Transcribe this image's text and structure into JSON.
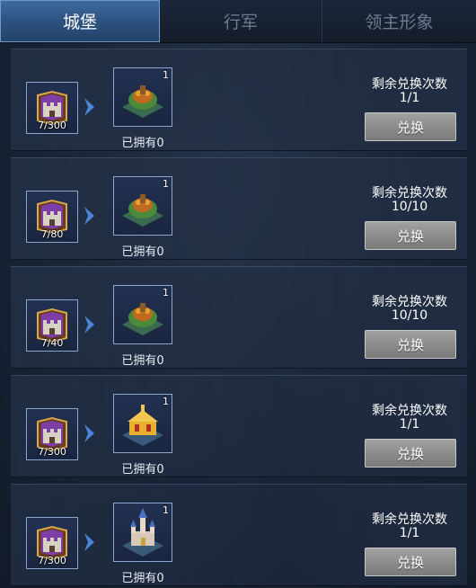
{
  "tabs": [
    {
      "label": "城堡",
      "active": true
    },
    {
      "label": "行军",
      "active": false
    },
    {
      "label": "领主形象",
      "active": false
    }
  ],
  "exchange_rows": [
    {
      "cost": "7/300",
      "quantity": "1",
      "owned": "已拥有0",
      "remain_label": "剩余兑换次数",
      "remain_value": "1/1",
      "button": "兑换",
      "reward_icon": "turtle-castle-icon"
    },
    {
      "cost": "7/80",
      "quantity": "1",
      "owned": "已拥有0",
      "remain_label": "剩余兑换次数",
      "remain_value": "10/10",
      "button": "兑换",
      "reward_icon": "turtle-castle-icon"
    },
    {
      "cost": "7/40",
      "quantity": "1",
      "owned": "已拥有0",
      "remain_label": "剩余兑换次数",
      "remain_value": "10/10",
      "button": "兑换",
      "reward_icon": "turtle-castle-icon"
    },
    {
      "cost": "7/300",
      "quantity": "1",
      "owned": "已拥有0",
      "remain_label": "剩余兑换次数",
      "remain_value": "1/1",
      "button": "兑换",
      "reward_icon": "golden-palace-icon"
    },
    {
      "cost": "7/300",
      "quantity": "1",
      "owned": "已拥有0",
      "remain_label": "剩余兑换次数",
      "remain_value": "1/1",
      "button": "兑换",
      "reward_icon": "fairy-castle-icon"
    }
  ],
  "colors": {
    "active_tab": "#2b4f7c",
    "button": "#8f8f8f",
    "background": "#1a2436"
  }
}
